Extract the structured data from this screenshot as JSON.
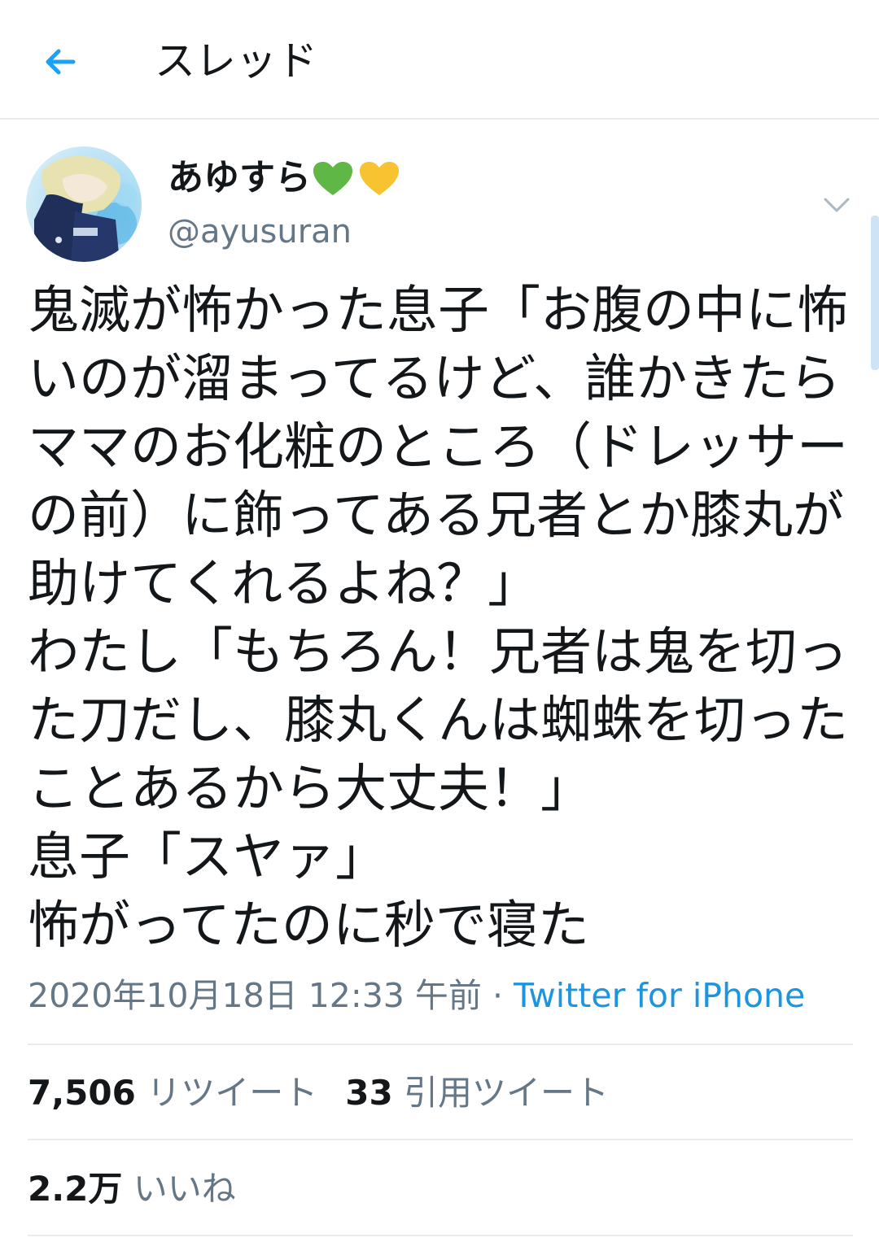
{
  "header": {
    "title": "スレッド",
    "back_icon": "back-arrow-icon"
  },
  "colors": {
    "accent": "#1da1f2",
    "link": "#1b95e0",
    "secondary_text": "#657786",
    "divider": "#e6ecf0"
  },
  "author": {
    "name": "あゆすら",
    "name_emoji": [
      "green-heart",
      "yellow-heart"
    ],
    "handle": "@ayusuran"
  },
  "tweet": {
    "text": "鬼滅が怖かった息子「お腹の中に怖\nいのが溜まってるけど、誰かきたら\nママのお化粧のところ（ドレッサー\nの前）に飾ってある兄者とか膝丸が\n助けてくれるよね？」\nわたし「もちろん！兄者は鬼を切っ\nた刀だし、膝丸くんは蜘蛛を切った\nことあるから大丈夫！」\n息子「スヤァ」\n怖がってたのに秒で寝た",
    "timestamp": "2020年10月18日 12:33 午前",
    "separator": " · ",
    "client": "Twitter for iPhone"
  },
  "stats": {
    "retweets_count": "7,506",
    "retweets_label": "リツイート",
    "quotes_count": "33",
    "quotes_label": "引用ツイート",
    "likes_count": "2.2万",
    "likes_label": "いいね"
  }
}
